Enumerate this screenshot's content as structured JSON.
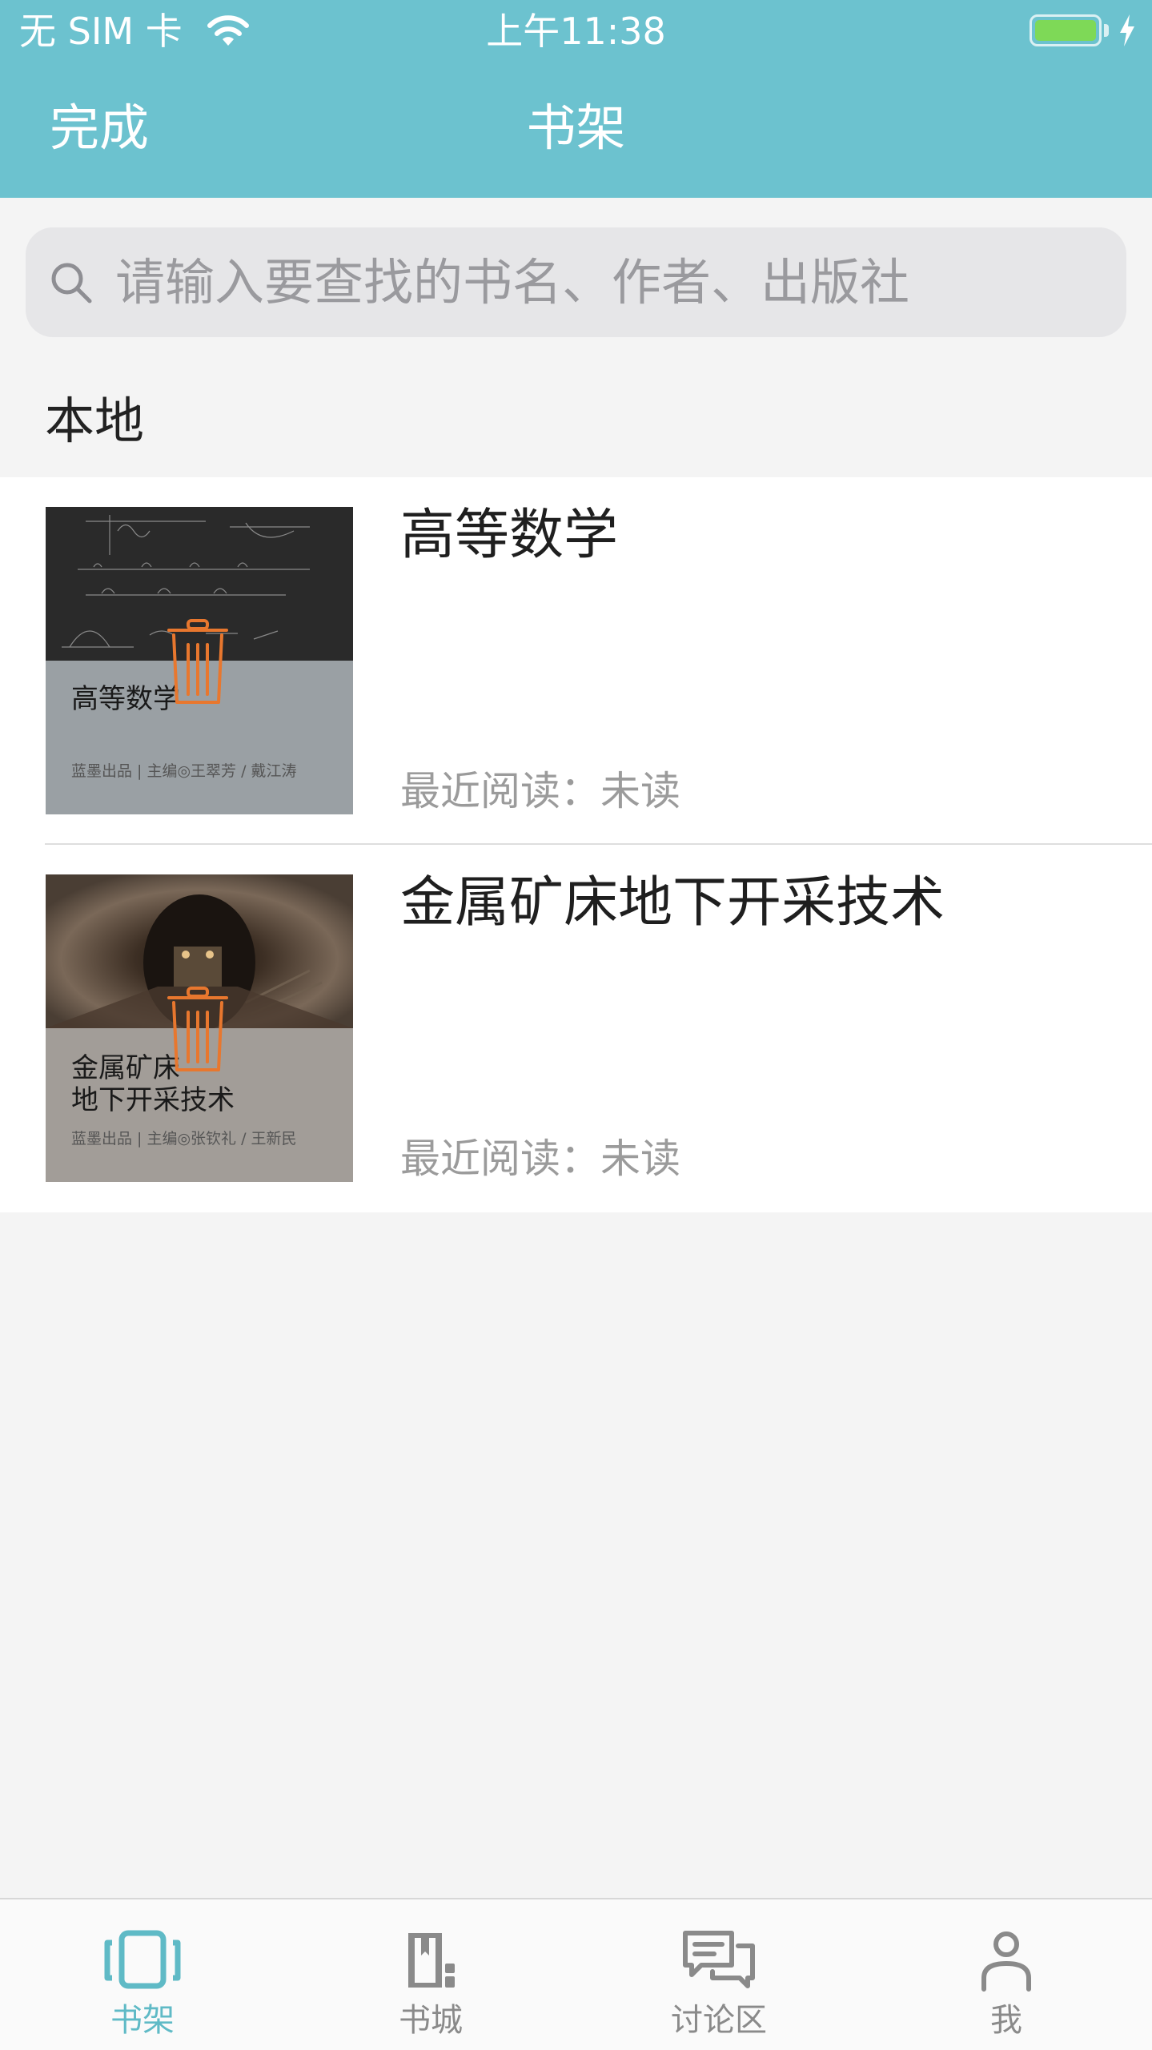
{
  "status_bar": {
    "carrier": "无 SIM 卡",
    "time": "上午11:38",
    "battery_level": 1.0,
    "charging": true
  },
  "nav": {
    "left_label": "完成",
    "title": "书架"
  },
  "search": {
    "placeholder": "请输入要查找的书名、作者、出版社",
    "value": ""
  },
  "section": {
    "title": "本地"
  },
  "books": [
    {
      "title": "高等数学",
      "progress": "最近阅读：未读",
      "cover_title": "高等数学",
      "cover_credit": "蓝墨出品 | 主编◎王翠芳 / 戴江涛",
      "cover_theme": "chalkboard"
    },
    {
      "title": "金属矿床地下开采技术",
      "progress": "最近阅读：未读",
      "cover_title": "金属矿床\n地下开采技术",
      "cover_credit": "蓝墨出品 | 主编◎张钦礼 / 王新民",
      "cover_theme": "mine-tunnel"
    }
  ],
  "tabbar": {
    "items": [
      {
        "label": "书架",
        "icon": "bookshelf-icon",
        "active": true
      },
      {
        "label": "书城",
        "icon": "bookstore-icon",
        "active": false
      },
      {
        "label": "讨论区",
        "icon": "discussion-icon",
        "active": false
      },
      {
        "label": "我",
        "icon": "profile-icon",
        "active": false
      }
    ]
  },
  "colors": {
    "accent": "#6cc2cf",
    "tab_active": "#5fbac6",
    "tab_inactive": "#8a8a8a",
    "delete": "#e8772e"
  }
}
